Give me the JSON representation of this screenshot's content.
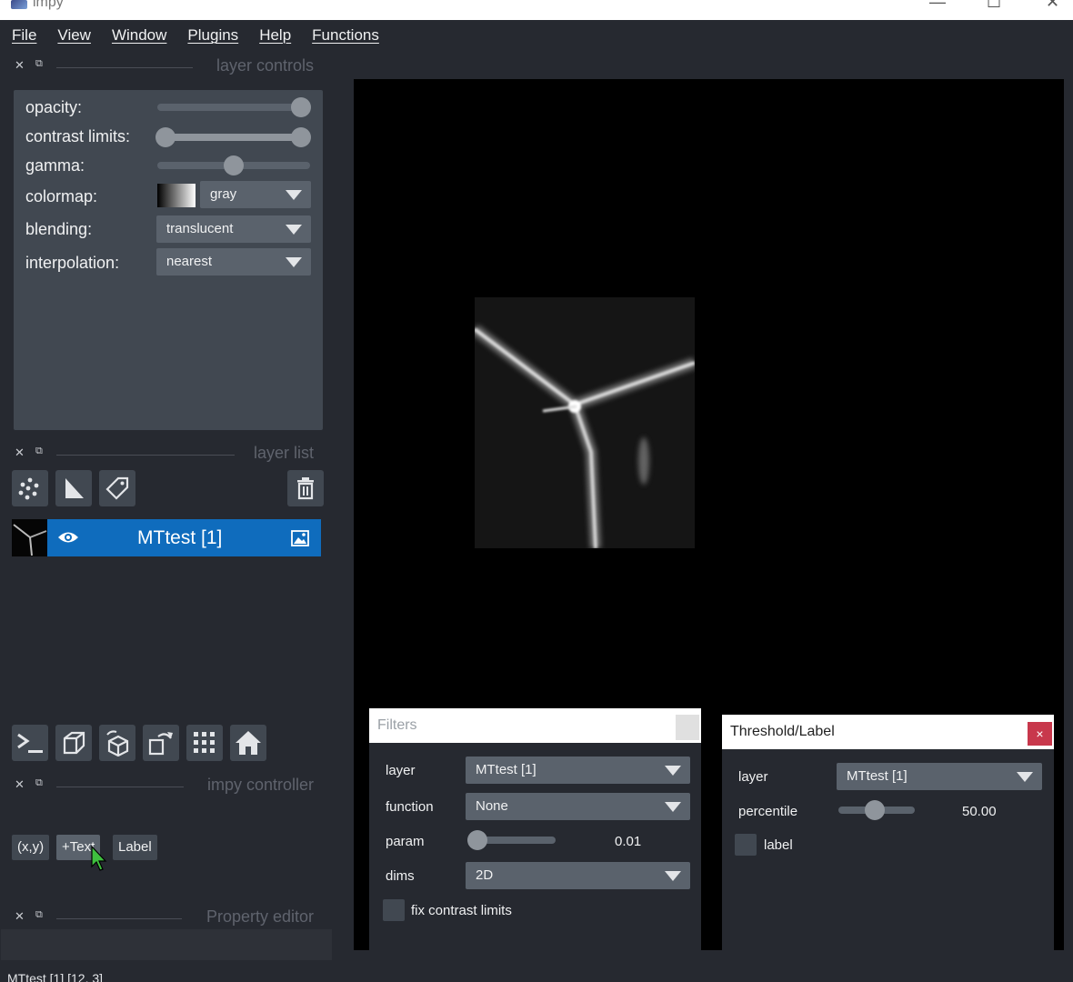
{
  "window": {
    "title": "impy",
    "controls": [
      "—",
      "☐",
      "✕"
    ]
  },
  "menu": [
    "File",
    "View",
    "Window",
    "Plugins",
    "Help",
    "Functions"
  ],
  "docks": {
    "layer_controls": "layer controls",
    "layer_list": "layer list",
    "impy_controller": "impy controller",
    "property_editor": "Property editor"
  },
  "layer_controls": {
    "opacity_label": "opacity:",
    "opacity_value": 1.0,
    "contrast_label": "contrast limits:",
    "contrast_range": [
      0.0,
      1.0
    ],
    "gamma_label": "gamma:",
    "gamma_value": 0.5,
    "colormap_label": "colormap:",
    "colormap_value": "gray",
    "blending_label": "blending:",
    "blending_value": "translucent",
    "interpolation_label": "interpolation:",
    "interpolation_value": "nearest"
  },
  "layer_list": {
    "tools": [
      "points-icon",
      "shapes-icon",
      "labels-icon"
    ],
    "delete": "delete-icon",
    "layers": [
      {
        "name": "MTtest [1]",
        "visible": true,
        "type": "image"
      }
    ]
  },
  "viewer_buttons": [
    "console-icon",
    "ndisplay-icon",
    "roll-icon",
    "transpose-icon",
    "grid-icon",
    "home-icon"
  ],
  "impy_controller": {
    "buttons": [
      "(x,y)",
      "+Text",
      "Label"
    ]
  },
  "status": "MTtest [1] [12, 3]",
  "filters": {
    "title": "Filters",
    "layer_label": "layer",
    "layer_value": "MTtest [1]",
    "function_label": "function",
    "function_value": "None",
    "param_label": "param",
    "param_value": "0.01",
    "dims_label": "dims",
    "dims_value": "2D",
    "fix_contrast_label": "fix contrast limits"
  },
  "threshold": {
    "title": "Threshold/Label",
    "close": "×",
    "layer_label": "layer",
    "layer_value": "MTtest [1]",
    "percentile_label": "percentile",
    "percentile_value": "50.00",
    "label_label": "label"
  }
}
